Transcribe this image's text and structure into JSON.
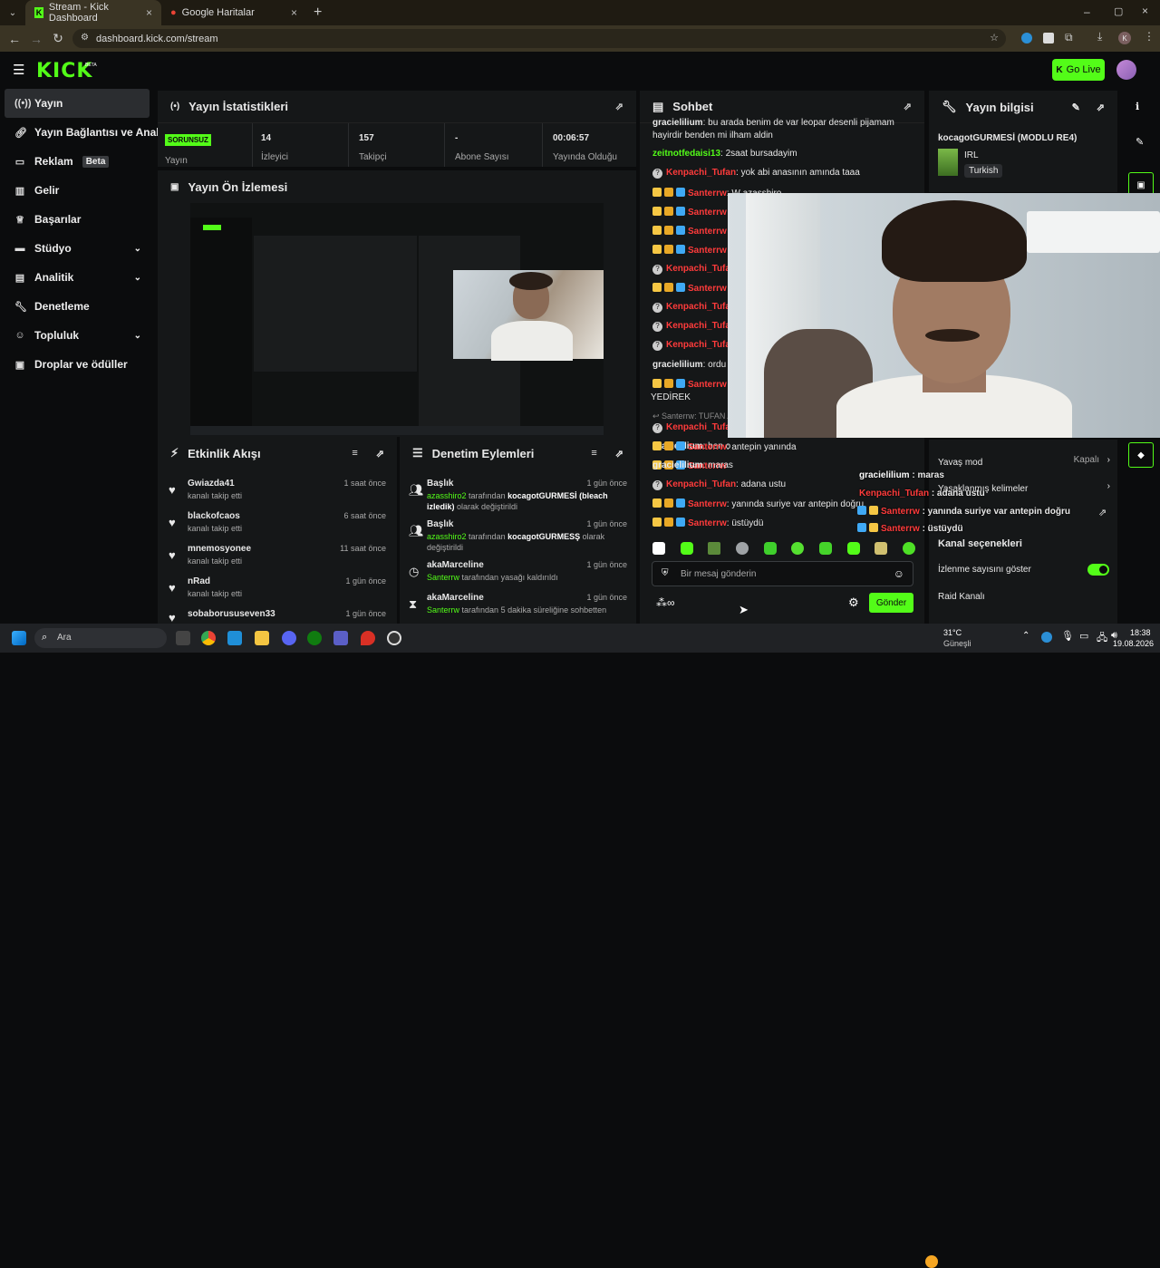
{
  "browser": {
    "tabs": [
      {
        "title": "Stream - Kick Dashboard",
        "active": true
      },
      {
        "title": "Google Haritalar",
        "active": false
      }
    ],
    "url": "dashboard.kick.com/stream",
    "profile_initial": "K"
  },
  "header": {
    "logo": "KICK",
    "logo_beta": "BETA",
    "go_live": "Go Live"
  },
  "sidebar": {
    "items": [
      {
        "label": "Yayın",
        "icon": "broadcast-icon"
      },
      {
        "label": "Yayın Bağlantısı ve Anahtar",
        "icon": "link-icon"
      },
      {
        "label": "Reklam",
        "icon": "ad-icon",
        "badge": "Beta"
      },
      {
        "label": "Gelir",
        "icon": "chart-icon"
      },
      {
        "label": "Başarılar",
        "icon": "trophy-icon"
      },
      {
        "label": "Stüdyo",
        "icon": "studio-icon"
      },
      {
        "label": "Analitik",
        "icon": "analytics-icon"
      },
      {
        "label": "Denetleme",
        "icon": "wrench-icon"
      },
      {
        "label": "Topluluk",
        "icon": "community-icon"
      },
      {
        "label": "Droplar ve ödüller",
        "icon": "gift-icon"
      }
    ]
  },
  "stats": {
    "title": "Yayın İstatistikleri",
    "status": "SORUNSUZ",
    "status_label": "Yayın",
    "viewers": "14",
    "viewers_label": "İzleyici",
    "followers": "157",
    "followers_label": "Takipçi",
    "subs": "-",
    "subs_label": "Abone Sayısı",
    "uptime": "00:06:57",
    "uptime_label": "Yayında Olduğu Süre"
  },
  "preview": {
    "title": "Yayın Ön İzlemesi"
  },
  "activity": {
    "title": "Etkinlik Akışı",
    "items": [
      {
        "name": "Gwiazda41",
        "action": "kanalı takip etti",
        "time": "1 saat önce"
      },
      {
        "name": "blackofcaos",
        "action": "kanalı takip etti",
        "time": "6 saat önce"
      },
      {
        "name": "mnemosyonee",
        "action": "kanalı takip etti",
        "time": "11 saat önce"
      },
      {
        "name": "nRad",
        "action": "kanalı takip etti",
        "time": "1 gün önce"
      },
      {
        "name": "sobaborususeven33",
        "action": "",
        "time": "1 gün önce"
      }
    ]
  },
  "moderation": {
    "title": "Denetim Eylemleri",
    "items": [
      {
        "title": "Başlık",
        "actor": "azasshiro2",
        "mid": "tarafından",
        "target": "kocagotGURMESİ (bleach izledik)",
        "end": "olarak değiştirildi",
        "time": "1 gün önce"
      },
      {
        "title": "Başlık",
        "actor": "azasshiro2",
        "mid": "tarafından",
        "target": "kocagotGURMESŞ",
        "end": "olarak değiştirildi",
        "time": "1 gün önce"
      },
      {
        "title": "akaMarceline",
        "actor": "Santerrw",
        "mid": "tarafından yasağı kaldırıldı",
        "target": "",
        "end": "",
        "time": "1 gün önce"
      },
      {
        "title": "akaMarceline",
        "actor": "Santerrw",
        "mid": "tarafından 5 dakika süreliğine sohbetten",
        "target": "",
        "end": "",
        "time": "1 gün önce"
      }
    ]
  },
  "chat": {
    "title": "Sohbet",
    "lines": [
      {
        "user": "gracielilium",
        "msg": ": bu arada benim de var leopar desenli pijamam"
      },
      {
        "user": "",
        "msg": "hayirdir benden mi ilham aldin"
      },
      {
        "user": "zeitnotfedaisi13",
        "msg": ": 2saat bursadayim"
      },
      {
        "user": "Kenpachi_Tufan",
        "msg": ": yok abi anasının amında taaa"
      },
      {
        "user": "Santerrw",
        "msg": ": W azasshiro"
      },
      {
        "user": "Santerrw",
        "msg": ""
      },
      {
        "user": "Santerrw",
        "msg": ""
      },
      {
        "user": "Santerrw",
        "msg": ""
      },
      {
        "user": "Kenpachi_Tufan",
        "msg": ""
      },
      {
        "user": "Santerrw",
        "msg": ""
      },
      {
        "user": "Kenpachi_Tufan",
        "msg": ""
      },
      {
        "user": "Kenpachi_Tufan",
        "msg": ""
      },
      {
        "user": "Kenpachi_Tufan",
        "msg": ""
      },
      {
        "user": "gracielilium",
        "msg": ": ordu r"
      },
      {
        "user": "Santerrw",
        "msg": ""
      },
      {
        "user": "",
        "msg": "YEDİREK"
      },
      {
        "user": "Santerrw",
        "msg": ": TUFAN A"
      },
      {
        "user": "Kenpachi_Tufan",
        "msg": ""
      },
      {
        "user": "gracielilium",
        "msg": ": ben o"
      },
      {
        "user": "Santerrw",
        "msg": ""
      },
      {
        "user": "Santerrw",
        "msg": ": antepin yanında"
      },
      {
        "user": "gracielilium",
        "msg": ": maras"
      },
      {
        "user": "Kenpachi_Tufan",
        "msg": ": adana ustu"
      },
      {
        "user": "Santerrw",
        "msg": ": yanında suriye var antepin doğru"
      },
      {
        "user": "Santerrw",
        "msg": ": üstüydü"
      }
    ],
    "input_placeholder": "Bir mesaj gönderin",
    "send_label": "Gönder"
  },
  "info": {
    "title": "Yayın bilgisi",
    "stream_title": "kocagotGURMESİ (MODLU RE4)",
    "category": "IRL",
    "tag": "Turkish"
  },
  "overlay": {
    "lines": [
      {
        "user": "gracielilium",
        "msg": " : maras"
      },
      {
        "user": "Kenpachi_Tufan",
        "msg": " : adana ustu"
      },
      {
        "user": "Santerrw",
        "msg": " : yanında suriye var antepin doğru"
      },
      {
        "user": "Santerrw",
        "msg": " : üstüydü"
      }
    ]
  },
  "settings": {
    "slow_mode": "Yavaş mod",
    "slow_mode_value": "Kapalı",
    "banned_words": "Yasaklanmış kelimeler",
    "channel_options": "Kanal seçenekleri",
    "show_viewers": "İzlenme sayısını göster",
    "raid": "Raid Kanalı"
  },
  "taskbar": {
    "search": "Ara",
    "weather_temp": "31°C",
    "weather_desc": "Güneşli",
    "time": "18:38",
    "date": "19.08.2026"
  },
  "colors": {
    "accent": "#53fc18",
    "panel": "#151718",
    "bg": "#0b0c0d",
    "red": "#ff3b3b"
  }
}
